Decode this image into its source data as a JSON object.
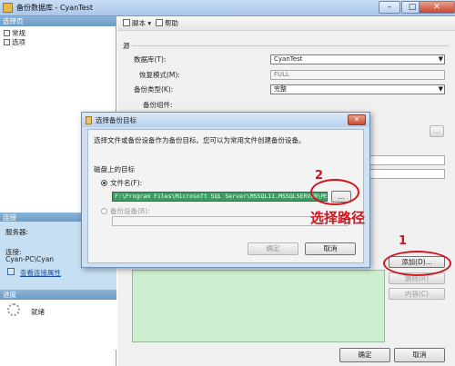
{
  "window": {
    "title": "备份数据库 - CyanTest",
    "controls": [
      "–",
      "□",
      "✕"
    ]
  },
  "left_pane": {
    "select_page_header": "选择页",
    "pages": [
      {
        "label": "常规",
        "icon": "page-icon"
      },
      {
        "label": "选项",
        "icon": "page-icon"
      }
    ],
    "connection_header": "连接",
    "server_label": "服务器:",
    "server_value": "",
    "connection_label": "连接:",
    "connection_value": "Cyan-PC\\Cyan",
    "view_conn_props": "查看连接属性",
    "progress_header": "进度",
    "progress_status": "就绪"
  },
  "toolbar": {
    "script_label": "脚本",
    "help_label": "帮助"
  },
  "source_section": {
    "header": "源",
    "database_label": "数据库(T):",
    "database_value": "CyanTest",
    "recovery_label": "恢复模式(M):",
    "recovery_value": "FULL",
    "backup_type_label": "备份类型(K):",
    "backup_type_value": "完整",
    "component_label": "备份组件:"
  },
  "destination_buttons": {
    "add": "添加(D)...",
    "remove": "删除(R)",
    "contents": "内容(C)"
  },
  "main_buttons": {
    "ok": "确定",
    "cancel": "取消"
  },
  "dialog": {
    "title": "选择备份目标",
    "description": "选择文件或备份设备作为备份目标。您可以为常用文件创建备份设备。",
    "disk_target_label": "磁盘上的目标",
    "file_name_label": "文件名(F):",
    "file_path": "F:\\Program Files\\Microsoft SQL Server\\MSSQL11.MSSQLSERVER\\MSSQL\\Backup\\",
    "browse_label": "...",
    "backup_device_label": "备份设备(B):",
    "ok": "确定",
    "cancel": "取消"
  },
  "annotations": {
    "step1_number": "1",
    "step2_number": "2",
    "step2_caption": "选择路径",
    "color": "#d2141c"
  }
}
